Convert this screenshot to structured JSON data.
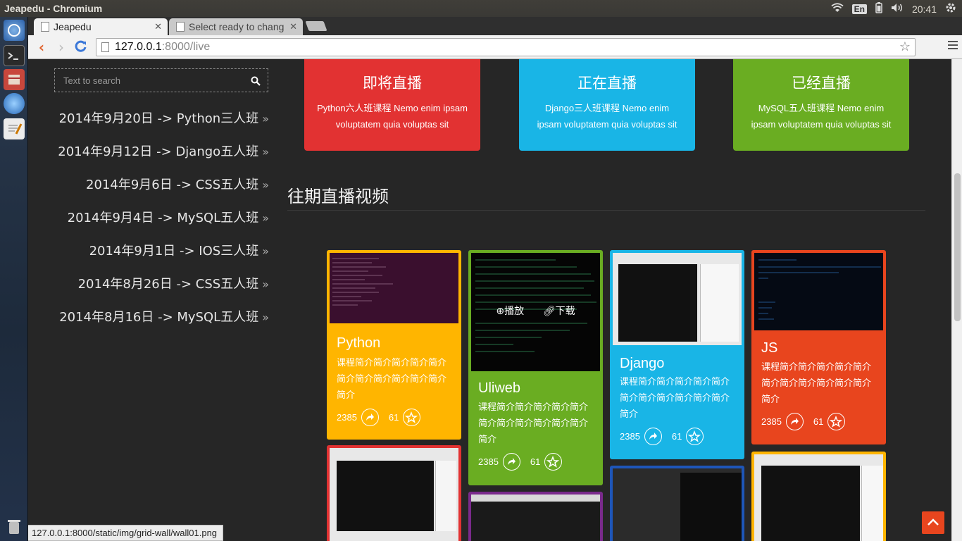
{
  "os": {
    "window_title": "Jeapedu - Chromium",
    "keyboard_layout": "En",
    "clock": "20:41"
  },
  "browser": {
    "tabs": [
      {
        "label": "Jeapedu",
        "active": true
      },
      {
        "label": "Select ready to chang",
        "active": false
      }
    ],
    "url_host": "127.0.0.1",
    "url_path": ":8000/live",
    "status_url": "127.0.0.1:8000/static/img/grid-wall/wall01.png"
  },
  "sidebar": {
    "search_placeholder": "Text to search",
    "dates": [
      "2014年9月20日 -> Python三人班",
      "2014年9月12日 -> Django五人班",
      "2014年9月6日 -> CSS五人班",
      "2014年9月4日 -> MySQL五人班",
      "2014年9月1日 -> IOS三人班",
      "2014年8月26日 -> CSS五人班",
      "2014年8月16日 -> MySQL五人班"
    ],
    "chevron": "»"
  },
  "status_cards": [
    {
      "title": "即将直播",
      "desc": "Python六人班课程 Nemo enim ipsam voluptatem quia voluptas sit",
      "color": "#e23232"
    },
    {
      "title": "正在直播",
      "desc": "Django三人班课程 Nemo enim ipsam voluptatem quia voluptas sit",
      "color": "#19b5e6"
    },
    {
      "title": "已经直播",
      "desc": "MySQL五人班课程  Nemo enim ipsam voluptatem quia voluptas sit",
      "color": "#6aad22"
    }
  ],
  "section_title": "往期直播视频",
  "videos": [
    {
      "title": "Python",
      "desc": "课程简介简介简介简介简介简介简介简介简介简介简介简介",
      "views": "2385",
      "likes": "61",
      "color": "#ffb500"
    },
    {
      "title": "Uliweb",
      "desc": "课程简介简介简介简介简介简介简介简介简介简介简介简介",
      "views": "2385",
      "likes": "61",
      "color": "#6aad22",
      "overlay_play": "播放",
      "overlay_download": "下载"
    },
    {
      "title": "Django",
      "desc": "课程简介简介简介简介简介简介简介简介简介简介简介简介",
      "views": "2385",
      "likes": "61",
      "color": "#19b5e6"
    },
    {
      "title": "JS",
      "desc": "课程简介简介简介简介简介简介简介简介简介简介简介简介",
      "views": "2385",
      "likes": "61",
      "color": "#e8451e"
    }
  ],
  "icons": {
    "search": "search-icon",
    "share": "share-icon",
    "like": "like-icon",
    "back_to_top": "chevron-up-icon"
  }
}
